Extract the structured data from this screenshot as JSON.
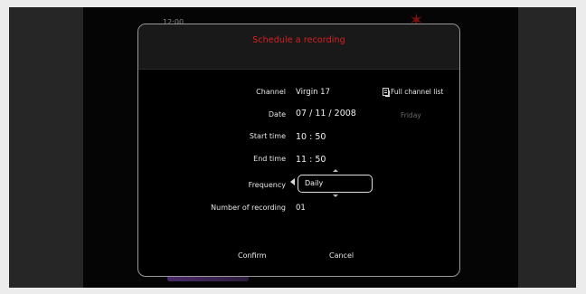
{
  "background": {
    "time_fragment": "12:00",
    "colors": {
      "tv": "#050505",
      "frame": "#262626",
      "page": "#ececec"
    }
  },
  "dialog": {
    "title": "Schedule a recording",
    "title_color": "#d92020",
    "fields": {
      "channel": {
        "label": "Channel",
        "value": "Virgin 17"
      },
      "date": {
        "label": "Date",
        "value": "07  /  11 /  2008",
        "weekday": "Friday"
      },
      "start_time": {
        "label": "Start time",
        "value": "10 : 50"
      },
      "end_time": {
        "label": "End time",
        "value": "11 : 50"
      },
      "frequency": {
        "label": "Frequency",
        "value": "Daily"
      },
      "number_of_recording": {
        "label": "Number of recording",
        "value": "01"
      }
    },
    "full_channel_list": "Full channel list",
    "buttons": {
      "confirm": "Confirm",
      "cancel": "Cancel"
    }
  }
}
